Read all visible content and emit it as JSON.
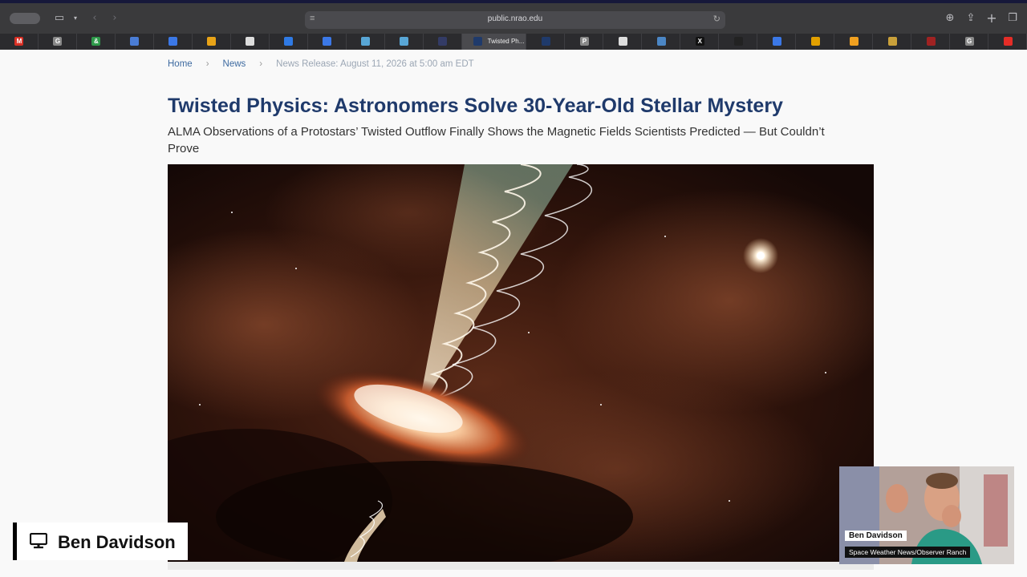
{
  "browser": {
    "url": "public.nrao.edu",
    "active_tab_title": "Twisted Ph...",
    "tab_favicons": [
      {
        "icon": "gmail-icon",
        "color": "#d93025",
        "glyph": "M"
      },
      {
        "icon": "google-icon",
        "color": "#888888",
        "glyph": "G"
      },
      {
        "icon": "ampersand-icon",
        "color": "#2e9a4a",
        "glyph": "&"
      },
      {
        "icon": "app-icon",
        "color": "#4a7dd6",
        "glyph": ""
      },
      {
        "icon": "docs-icon",
        "color": "#3b78e7",
        "glyph": ""
      },
      {
        "icon": "chart-icon",
        "color": "#e8a317",
        "glyph": ""
      },
      {
        "icon": "file-icon",
        "color": "#dddddd",
        "glyph": ""
      },
      {
        "icon": "globe-icon",
        "color": "#2f7ae5",
        "glyph": ""
      },
      {
        "icon": "docs-icon",
        "color": "#3b78e7",
        "glyph": ""
      },
      {
        "icon": "nasa-icon",
        "color": "#58a6d6",
        "glyph": ""
      },
      {
        "icon": "nasa-icon",
        "color": "#58a6d6",
        "glyph": ""
      },
      {
        "icon": "planet-icon",
        "color": "#333b66",
        "glyph": ""
      },
      {
        "icon": "nrao-icon",
        "color": "#1f3a6b",
        "glyph": ""
      },
      {
        "icon": "p-icon",
        "color": "#888888",
        "glyph": "P"
      },
      {
        "icon": "news-icon",
        "color": "#dddddd",
        "glyph": ""
      },
      {
        "icon": "weather-icon",
        "color": "#4b86c5",
        "glyph": ""
      },
      {
        "icon": "x-icon",
        "color": "#111111",
        "glyph": "X"
      },
      {
        "icon": "circle-icon",
        "color": "#222222",
        "glyph": ""
      },
      {
        "icon": "docs-icon",
        "color": "#3b78e7",
        "glyph": ""
      },
      {
        "icon": "sun-icon",
        "color": "#e2a000",
        "glyph": ""
      },
      {
        "icon": "sun-icon",
        "color": "#f0a020",
        "glyph": ""
      },
      {
        "icon": "face-icon",
        "color": "#c9a03a",
        "glyph": ""
      },
      {
        "icon": "space-icon",
        "color": "#a02222",
        "glyph": ""
      },
      {
        "icon": "google-icon",
        "color": "#888888",
        "glyph": "G"
      },
      {
        "icon": "youtube-icon",
        "color": "#e52d27",
        "glyph": ""
      }
    ]
  },
  "breadcrumb": {
    "home": "Home",
    "news": "News",
    "separator": "›",
    "current": "News Release: August 11, 2026 at 5:00 am EDT"
  },
  "article": {
    "title": "Twisted Physics: Astronomers Solve 30-Year-Old Stellar Mystery",
    "subtitle": "ALMA Observations of a Protostars’ Twisted Outflow Finally Shows the Magnetic Fields Scientists Predicted — But Couldn’t Prove"
  },
  "presenter": {
    "name": "Ben Davidson",
    "webcam_name": "Ben Davidson",
    "webcam_subtitle": "Space Weather News/Observer Ranch"
  },
  "colors": {
    "title": "#1f3a6b",
    "link": "#3d6aa0"
  }
}
